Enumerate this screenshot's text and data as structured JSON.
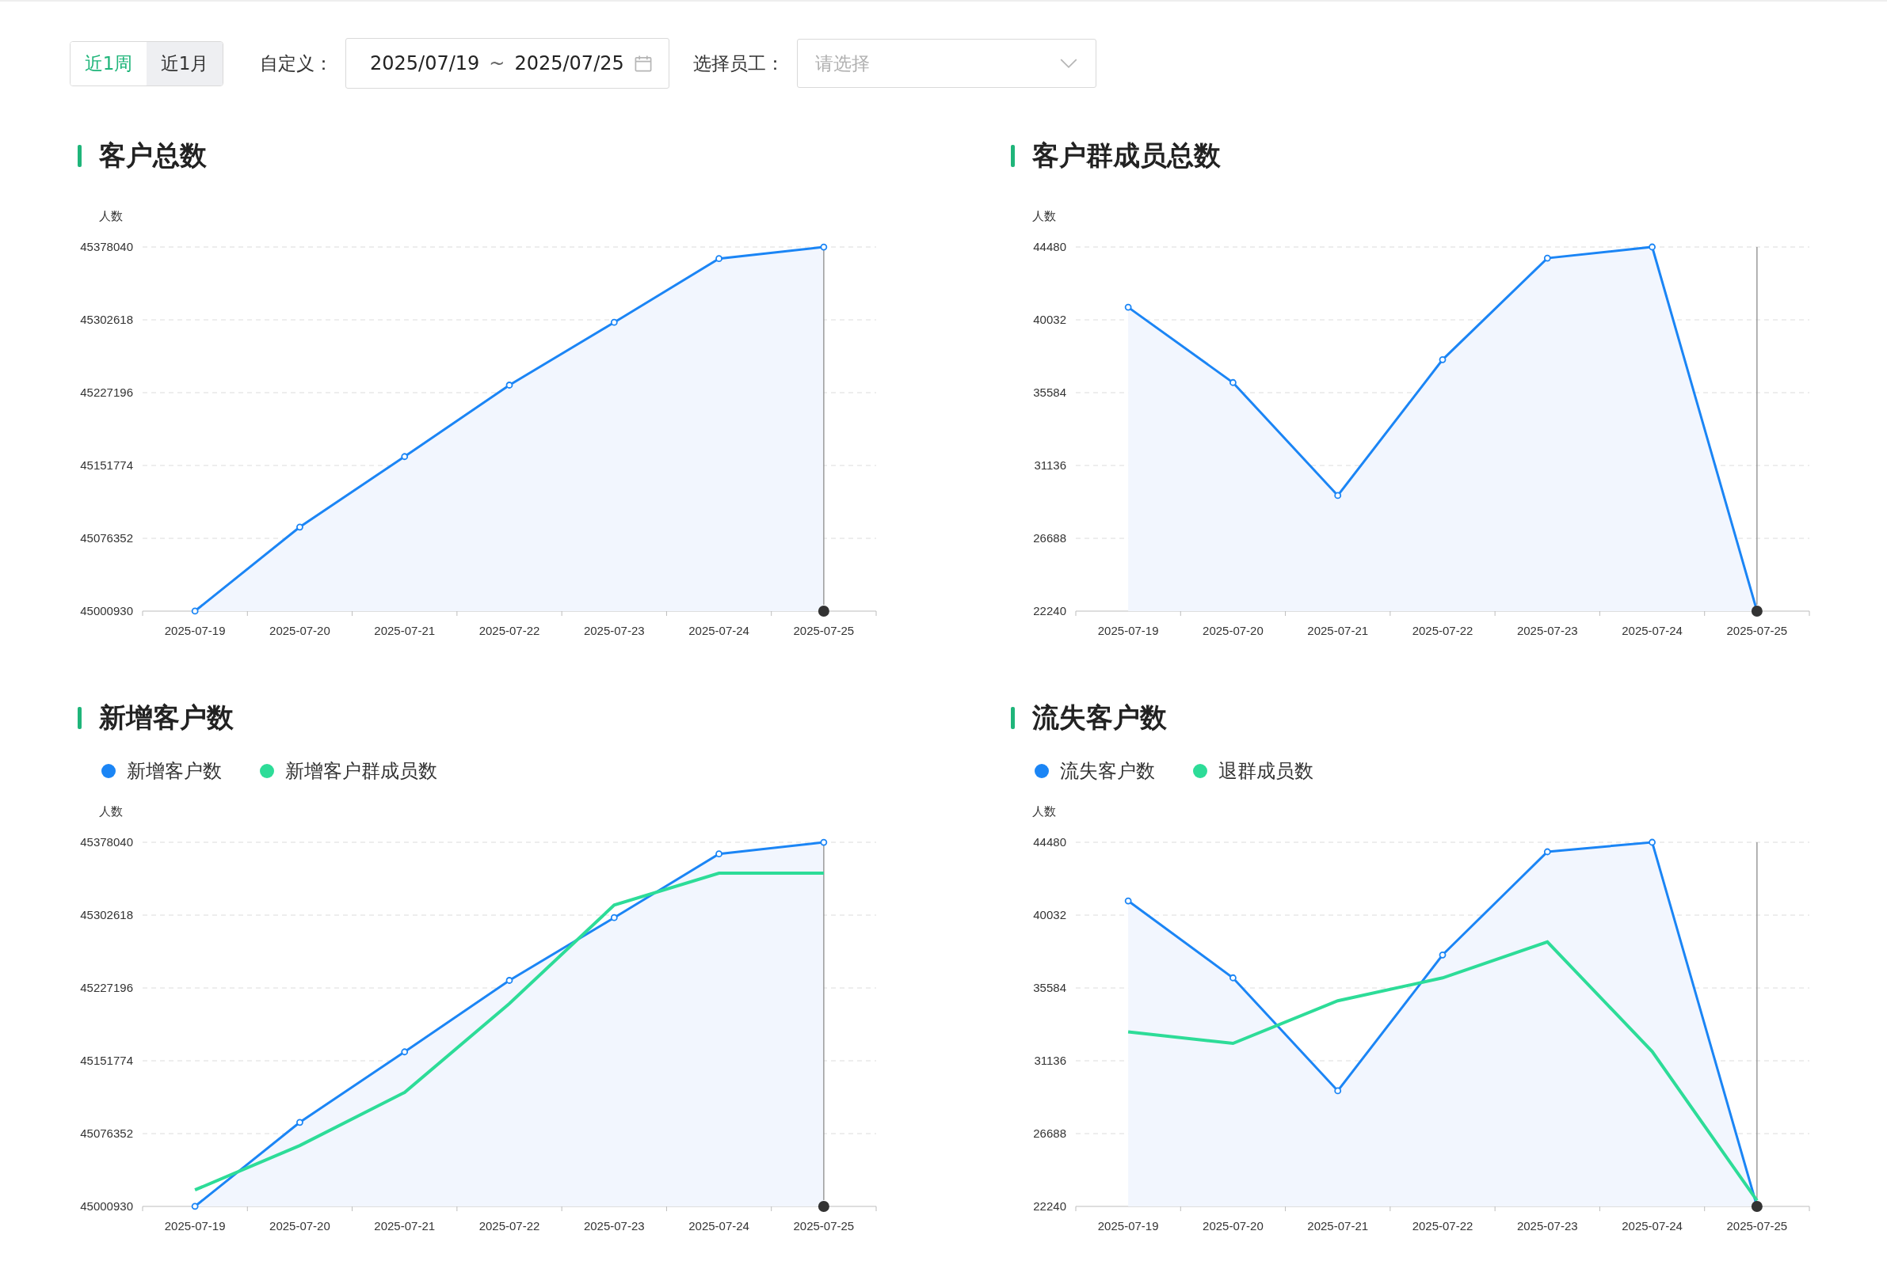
{
  "filters": {
    "range_tabs": [
      {
        "label": "近1周",
        "selected": true
      },
      {
        "label": "近1月",
        "selected": false
      }
    ],
    "custom_label": "自定义：",
    "date_start": "2025/07/19",
    "date_separator": "~",
    "date_end": "2025/07/25",
    "staff_label": "选择员工：",
    "staff_select": {
      "placeholder": "请选择"
    }
  },
  "panels": [
    {
      "title": "客户总数",
      "chart_data": {
        "type": "area",
        "ylabel": "人数",
        "grid": true,
        "categories": [
          "2025-07-19",
          "2025-07-20",
          "2025-07-21",
          "2025-07-22",
          "2025-07-23",
          "2025-07-24",
          "2025-07-25"
        ],
        "ylim": [
          45000930,
          45378040
        ],
        "yticks": [
          45000930,
          45076352,
          45151774,
          45227196,
          45302618,
          45378040
        ],
        "ref_lines": [
          {
            "axis": "x",
            "value": "2025-07-25"
          }
        ],
        "series": [
          {
            "type": "area",
            "color": "#1b85f5",
            "values": [
              45001000,
              45088000,
              45161000,
              45235000,
              45300000,
              45366000,
              45378000
            ]
          }
        ]
      }
    },
    {
      "title": "客户群成员总数",
      "chart_data": {
        "type": "area",
        "ylabel": "人数",
        "grid": true,
        "categories": [
          "2025-07-19",
          "2025-07-20",
          "2025-07-21",
          "2025-07-22",
          "2025-07-23",
          "2025-07-24",
          "2025-07-25"
        ],
        "ylim": [
          22240,
          44480
        ],
        "yticks": [
          22240,
          26688,
          31136,
          35584,
          40032,
          44480
        ],
        "ref_lines": [
          {
            "axis": "x",
            "value": "2025-07-25"
          }
        ],
        "series": [
          {
            "type": "area",
            "color": "#1b85f5",
            "values": [
              40800,
              36200,
              29300,
              37600,
              43800,
              44480,
              22240
            ]
          }
        ]
      }
    },
    {
      "title": "新增客户数",
      "chart_data": {
        "type": "area",
        "ylabel": "人数",
        "grid": true,
        "categories": [
          "2025-07-19",
          "2025-07-20",
          "2025-07-21",
          "2025-07-22",
          "2025-07-23",
          "2025-07-24",
          "2025-07-25"
        ],
        "ylim": [
          45000930,
          45378040
        ],
        "yticks": [
          45000930,
          45076352,
          45151774,
          45227196,
          45302618,
          45378040
        ],
        "ref_lines": [
          {
            "axis": "x",
            "value": "2025-07-25"
          }
        ],
        "series": [
          {
            "name": "新增客户数",
            "type": "area",
            "color": "#1b85f5",
            "values": [
              45001000,
              45088000,
              45161000,
              45235000,
              45300000,
              45366000,
              45378000
            ]
          },
          {
            "name": "新增客户群成员数",
            "type": "line",
            "color": "#2ddc98",
            "values": [
              45018000,
              45064000,
              45119000,
              45211000,
              45313000,
              45346000,
              45346000
            ]
          }
        ]
      }
    },
    {
      "title": "流失客户数",
      "chart_data": {
        "type": "area",
        "ylabel": "人数",
        "grid": true,
        "categories": [
          "2025-07-19",
          "2025-07-20",
          "2025-07-21",
          "2025-07-22",
          "2025-07-23",
          "2025-07-24",
          "2025-07-25"
        ],
        "ylim": [
          22240,
          44480
        ],
        "yticks": [
          22240,
          26688,
          31136,
          35584,
          40032,
          44480
        ],
        "ref_lines": [
          {
            "axis": "x",
            "value": "2025-07-25"
          }
        ],
        "series": [
          {
            "name": "流失客户数",
            "type": "area",
            "color": "#1b85f5",
            "values": [
              40900,
              36200,
              29300,
              37600,
              43900,
              44480,
              22240
            ]
          },
          {
            "name": "退群成员数",
            "type": "line",
            "color": "#2ddc98",
            "values": [
              32900,
              32200,
              34800,
              36200,
              38400,
              31700,
              22600
            ]
          }
        ]
      }
    }
  ]
}
